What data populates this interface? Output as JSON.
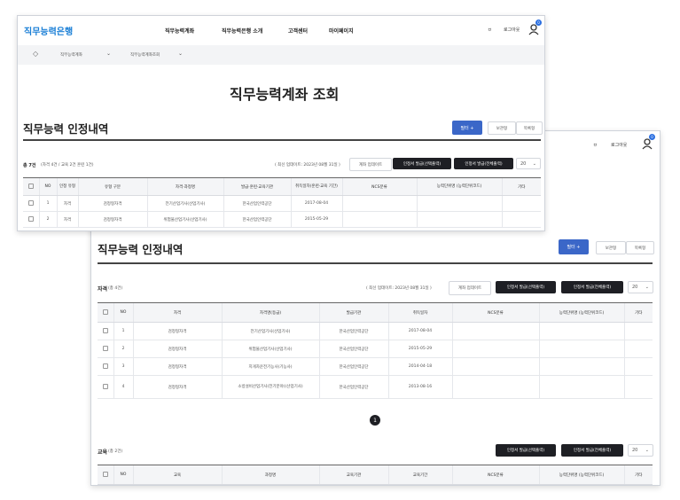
{
  "header": {
    "logo": "직무능력은행",
    "nav": [
      "직무능력계좌",
      "직무능력은행 소개",
      "고객센터",
      "마이페이지"
    ],
    "lang": "ㅂ",
    "login": "로그아웃",
    "badge_count": "0"
  },
  "breadcrumb": {
    "home_icon": "home-icon",
    "items": [
      "직무능력계좌",
      "직무능력계좌조회"
    ]
  },
  "page_title": "직무능력계좌 조회",
  "section_title": "직무능력 인정내역",
  "filter_button": "필터 +",
  "view_toggle": {
    "card": "보관형",
    "list": "목록형"
  },
  "front_summary": {
    "count": "총 7건",
    "detail": "(자격 4건 / 교육 2건 훈련 1건)",
    "updated": "( 최신 업데이트: 2023년 08월 31일 )",
    "update_btn": "계좌 업데이트",
    "issue_selected": "인정서 발급(선택출력)",
    "issue_all": "인정서 발급(전체출력)",
    "page_size": "20"
  },
  "front_table": {
    "headers": [
      "",
      "NO",
      "인정 유형",
      "유형 구분",
      "자격·과정명",
      "발급·훈련·교육기관",
      "취득일자(훈련·교육 기간)",
      "NCS분류",
      "능력단위명 (능력단위코드)",
      "기타"
    ],
    "rows": [
      [
        "",
        "1",
        "자격",
        "검정형자격",
        "전기산업기사(산업기사)",
        "한국산업인력공단",
        "2017-08-04",
        "",
        "",
        ""
      ],
      [
        "",
        "2",
        "자격",
        "검정형자격",
        "위험물산업기사(산업기사)",
        "한국산업인력공단",
        "2015-05-29",
        "",
        "",
        ""
      ]
    ]
  },
  "qual_section": {
    "label": "자격",
    "count": "(총 4건)",
    "updated": "( 최신 업데이트: 2023년 08월 31일 )",
    "update_btn": "계좌 업데이트",
    "issue_selected": "인정서 발급(선택출력)",
    "issue_all": "인정서 발급(전체출력)",
    "page_size": "20",
    "headers": [
      "",
      "NO",
      "자격",
      "자격명(등급)",
      "발급기관",
      "취득일자",
      "NCS분류",
      "능력단위명 (능력단위코드)",
      "기타"
    ],
    "rows": [
      [
        "",
        "1",
        "검정형자격",
        "전기산업기사(산업기사)",
        "한국산업인력공단",
        "2017-08-04",
        "",
        "",
        ""
      ],
      [
        "",
        "2",
        "검정형자격",
        "위험물산업기사(산업기사)",
        "한국산업인력공단",
        "2015-05-29",
        "",
        "",
        ""
      ],
      [
        "",
        "3",
        "검정형자격",
        "지게차운전기능사(기능사)",
        "한국산업인력공단",
        "2014-04-18",
        "",
        "",
        ""
      ],
      [
        "",
        "4",
        "검정형자격",
        "소방설비산업기사(전기분야)(산업기사)",
        "한국산업인력공단",
        "2013-08-16",
        "",
        "",
        ""
      ]
    ],
    "page": "1"
  },
  "edu_section": {
    "label": "교육",
    "count": "(총 2건)",
    "issue_selected": "인정서 발급(선택출력)",
    "issue_all": "인정서 발급(전체출력)",
    "page_size": "20",
    "headers": [
      "",
      "NO",
      "교육",
      "과정명",
      "교육기관",
      "교육기간",
      "NCS분류",
      "능력단위명 (능력단위코드)",
      "기타"
    ]
  }
}
